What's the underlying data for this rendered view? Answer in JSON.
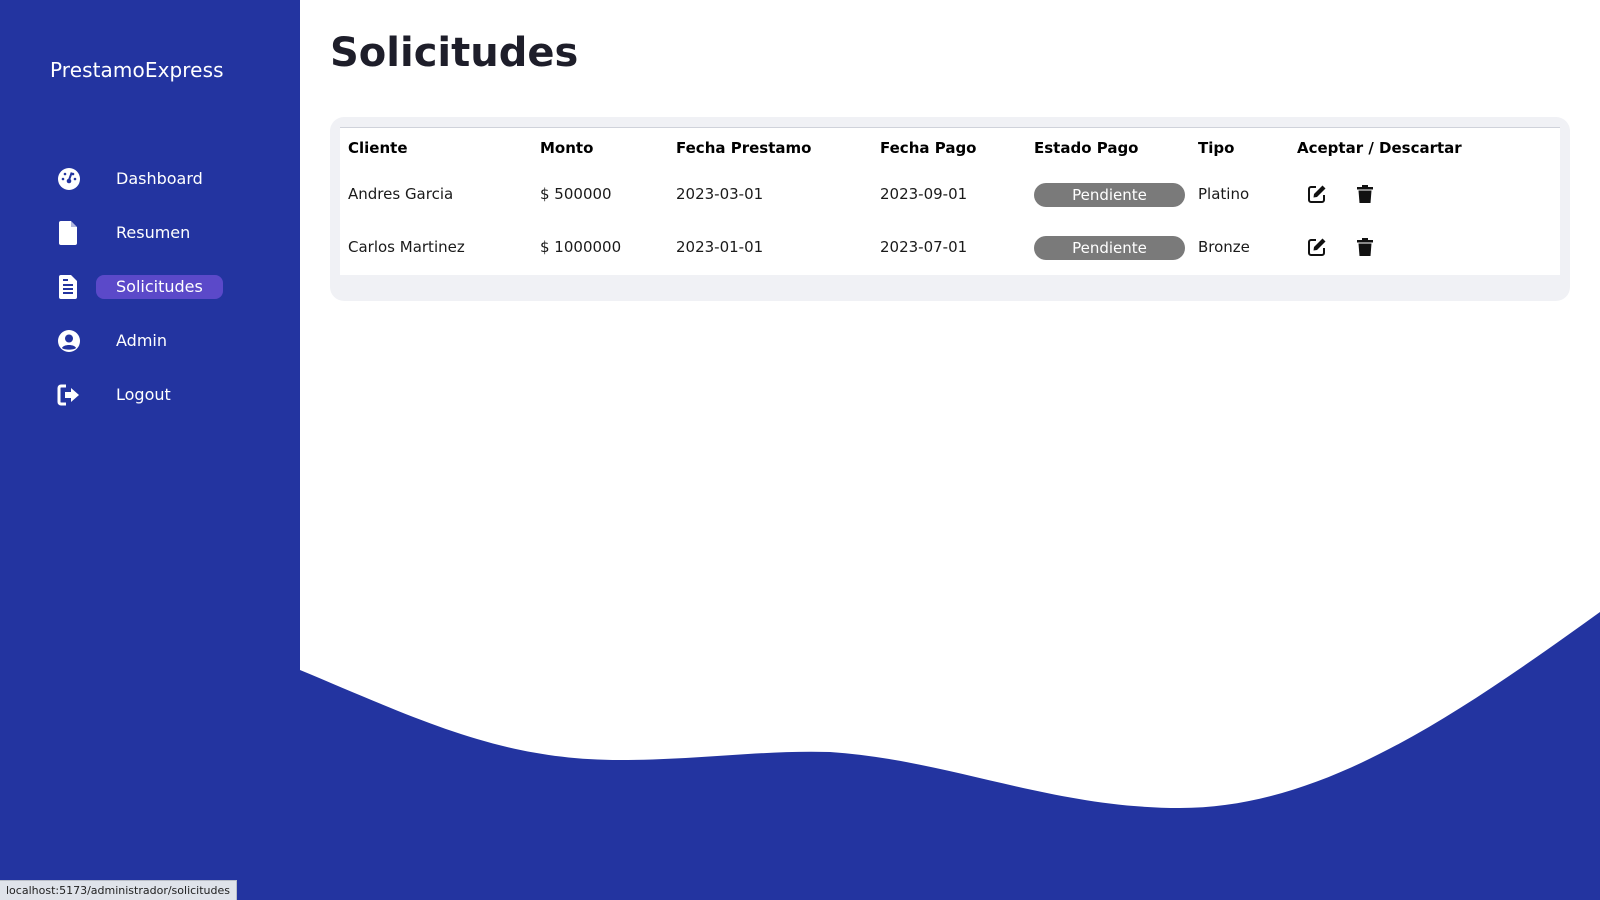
{
  "sidebar": {
    "brand": "PrestamoExpress",
    "items": [
      {
        "label": "Dashboard",
        "icon": "dashboard-gauge-icon"
      },
      {
        "label": "Resumen",
        "icon": "file-icon"
      },
      {
        "label": "Solicitudes",
        "icon": "file-alt-icon",
        "active": true
      },
      {
        "label": "Admin",
        "icon": "user-circle-icon"
      },
      {
        "label": "Logout",
        "icon": "logout-icon"
      }
    ]
  },
  "main": {
    "title": "Solicitudes",
    "table": {
      "headers": [
        "Cliente",
        "Monto",
        "Fecha Prestamo",
        "Fecha Pago",
        "Estado Pago",
        "Tipo",
        "Aceptar / Descartar"
      ],
      "rows": [
        {
          "cliente": "Andres Garcia",
          "monto": "$ 500000",
          "fecha_prestamo": "2023-03-01",
          "fecha_pago": "2023-09-01",
          "estado": "Pendiente",
          "tipo": "Platino"
        },
        {
          "cliente": "Carlos Martinez",
          "monto": "$ 1000000",
          "fecha_prestamo": "2023-01-01",
          "fecha_pago": "2023-07-01",
          "estado": "Pendiente",
          "tipo": "Bronze"
        }
      ],
      "actions": {
        "edit_icon": "edit-icon",
        "delete_icon": "trash-icon"
      }
    }
  },
  "statusbar": {
    "url": "localhost:5173/administrador/solicitudes"
  },
  "colors": {
    "primary": "#2334a0",
    "active_nav": "#5b49c9",
    "badge": "#7a7a7a"
  }
}
